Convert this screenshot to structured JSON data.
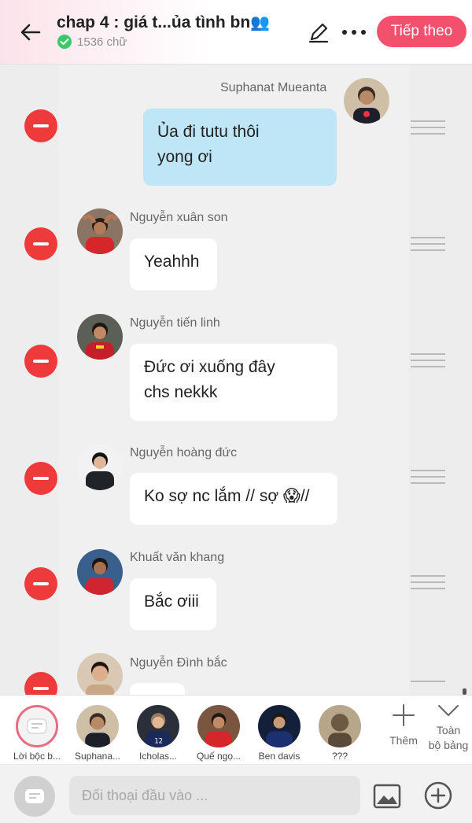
{
  "header": {
    "title": "chap 4 : giá t...ủa tình bn",
    "title_emoji": "👥",
    "word_count": "1536 chữ",
    "next_label": "Tiếp theo"
  },
  "messages": [
    {
      "speaker": "Suphanat Mueanta",
      "text_lines": [
        "Ủa đi tutu thôi",
        "yong ơi"
      ],
      "side": "right",
      "avatar": "suphanat-avatar"
    },
    {
      "speaker": "Nguyễn xuân son",
      "text_lines": [
        "Yeahhh"
      ],
      "side": "left",
      "avatar": "xuan-son-avatar"
    },
    {
      "speaker": "Nguyễn tiến linh",
      "text_lines": [
        "Đức ơi xuống đây",
        "chs nekkk"
      ],
      "side": "left",
      "avatar": "tien-linh-avatar"
    },
    {
      "speaker": "Nguyễn hoàng đức",
      "text_lines": [
        "Ko sợ nc lắm // sợ 😱//"
      ],
      "side": "left",
      "avatar": "hoang-duc-avatar"
    },
    {
      "speaker": "Khuất văn khang",
      "text_lines": [
        "Bắc ơiii"
      ],
      "side": "left",
      "avatar": "van-khang-avatar"
    },
    {
      "speaker": "Nguyễn Đình bắc",
      "text_lines": [
        ""
      ],
      "side": "left",
      "avatar": "dinh-bac-avatar"
    }
  ],
  "roles": [
    {
      "label": "Lời bộc b...",
      "icon": "narration-icon"
    },
    {
      "label": "Suphana...",
      "icon": "avatar"
    },
    {
      "label": "Icholas...",
      "icon": "avatar"
    },
    {
      "label": "Quế ngọ...",
      "icon": "avatar"
    },
    {
      "label": "Ben davis",
      "icon": "avatar"
    },
    {
      "label": "???",
      "icon": "avatar"
    }
  ],
  "role_actions": {
    "add_label": "Thêm",
    "full_table_line1": "Toàn",
    "full_table_line2": "bộ bảng"
  },
  "input": {
    "placeholder": "Đối thoại đầu vào ..."
  },
  "colors": {
    "accent": "#f2506d",
    "delete": "#ee3a3a",
    "self_bubble": "#bfe6f7"
  }
}
